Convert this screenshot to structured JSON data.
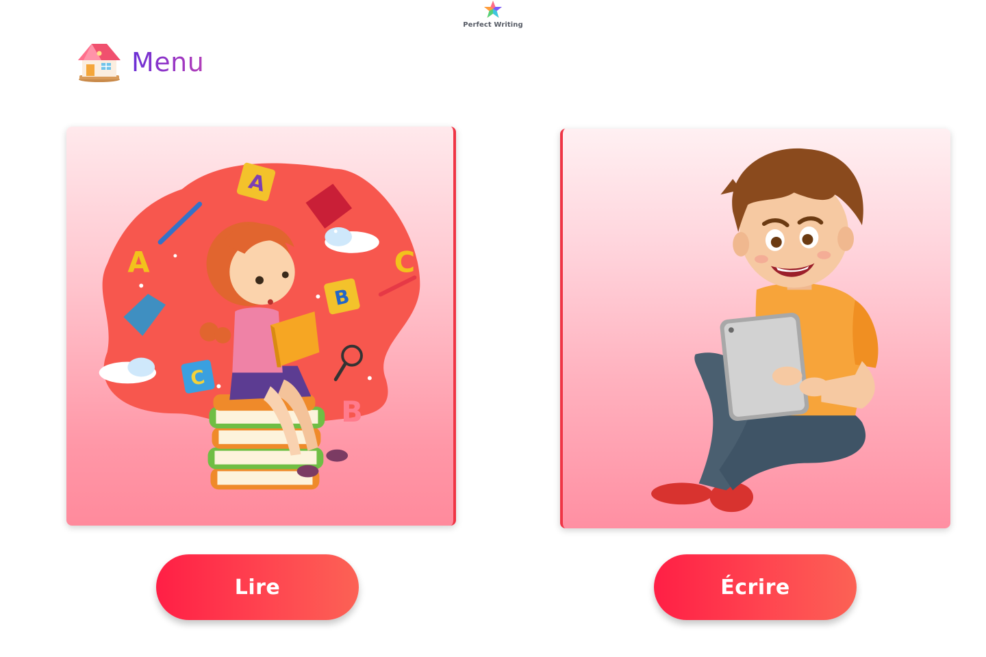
{
  "app": {
    "logo_text": "Perfect Writing",
    "logo_icon": "star-logo-icon"
  },
  "menu": {
    "label": "Menu",
    "icon": "house-icon"
  },
  "cards": [
    {
      "id": "read",
      "illustration": "girl-reading-illustration",
      "button_label": "Lire"
    },
    {
      "id": "write",
      "illustration": "boy-with-tablet-illustration",
      "button_label": "Écrire"
    }
  ],
  "colors": {
    "button_gradient_start": "#ff1f45",
    "button_gradient_end": "#fc6255",
    "menu_gradient_start": "#6a2fd6",
    "menu_gradient_end": "#b23fb8",
    "card_accent": "#ef3545"
  }
}
